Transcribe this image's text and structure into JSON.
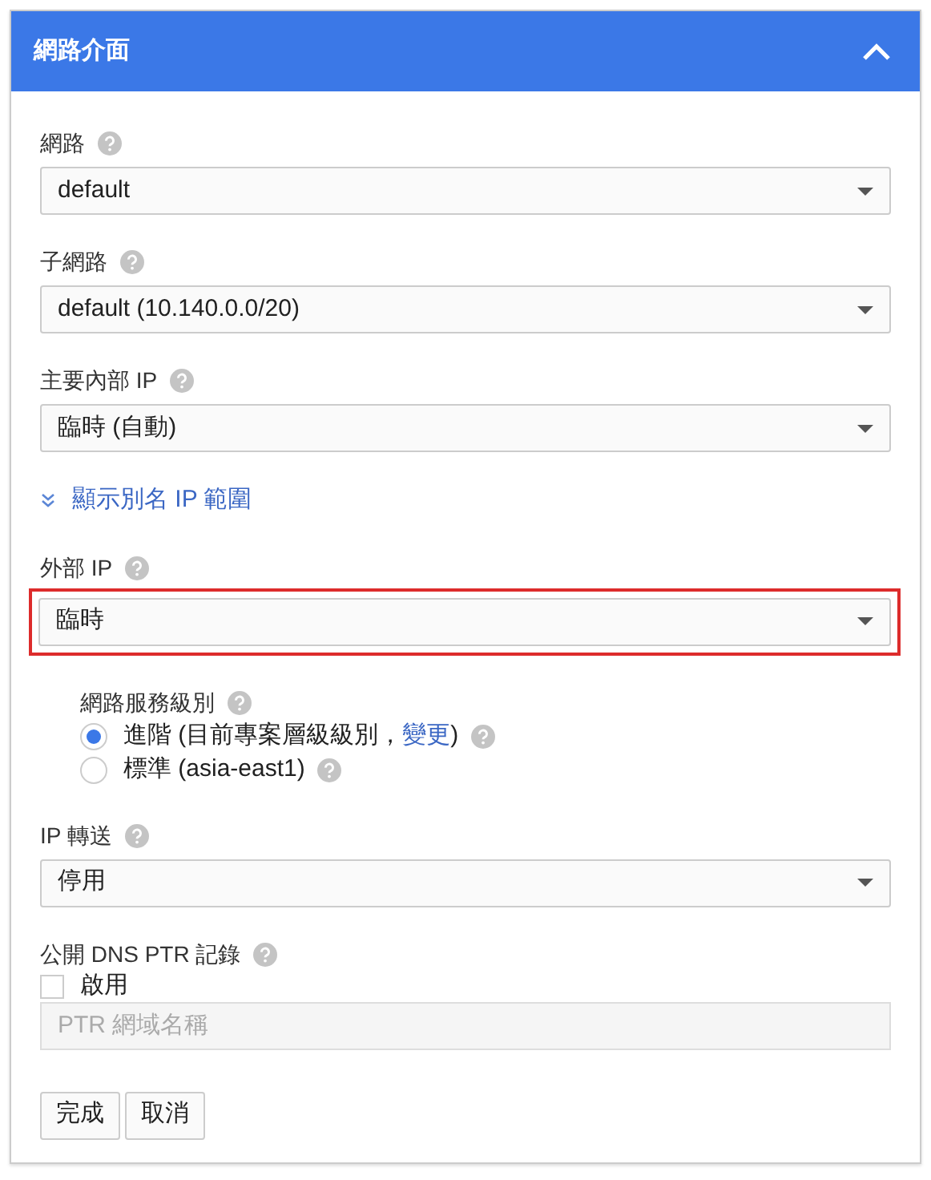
{
  "panel": {
    "title": "網路介面",
    "expanded": true
  },
  "fields": [
    {
      "kind": "select",
      "label": "網路",
      "value": "default",
      "highlighted": false
    },
    {
      "kind": "select",
      "label": "子網路",
      "value": "default (10.140.0.0/20)",
      "highlighted": false
    },
    {
      "kind": "select",
      "label": "主要內部 IP",
      "value": "臨時 (自動)",
      "highlighted": false
    },
    {
      "kind": "link",
      "text": "顯示別名 IP 範圍"
    },
    {
      "kind": "select",
      "label": "外部 IP",
      "value": "臨時",
      "highlighted": true
    },
    {
      "kind": "radio",
      "label": "網路服務級別",
      "options": [
        {
          "text": "進階 (目前專案層級級別，",
          "link": "變更",
          "suffix": ")",
          "selected": true
        },
        {
          "text": "標準 (asia-east1)",
          "selected": false
        }
      ]
    },
    {
      "kind": "select",
      "label": "IP 轉送",
      "value": "停用",
      "highlighted": false
    },
    {
      "kind": "checkbox",
      "label": "公開 DNS PTR 記錄",
      "option": "啟用",
      "checked": false,
      "placeholder": "PTR 網域名稱"
    }
  ],
  "buttons": [
    "完成",
    "取消"
  ]
}
